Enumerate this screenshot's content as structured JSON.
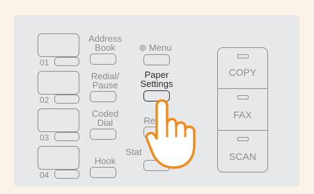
{
  "one_touch": [
    {
      "number": "01"
    },
    {
      "number": "02"
    },
    {
      "number": "03"
    },
    {
      "number": "04"
    }
  ],
  "function_keys": {
    "address_book": {
      "line1": "Address",
      "line2": "Book"
    },
    "redial_pause": {
      "line1": "Redial/",
      "line2": "Pause"
    },
    "coded_dial": {
      "line1": "Coded",
      "line2": "Dial"
    },
    "hook": {
      "label": "Hook"
    }
  },
  "settings_keys": {
    "menu": {
      "symbol": "⊛",
      "label": "Menu"
    },
    "paper_settings": {
      "line1": "Paper",
      "line2": "Settings"
    },
    "report_partial": {
      "label": "Re    rt"
    },
    "status_partial": {
      "label": "Stat"
    }
  },
  "mode_keys": [
    {
      "label": "COPY"
    },
    {
      "label": "FAX"
    },
    {
      "label": "SCAN"
    }
  ],
  "colors": {
    "hand_outline": "#f08c1e",
    "panel": "#e7e8ea",
    "background": "#fbf4e6"
  }
}
